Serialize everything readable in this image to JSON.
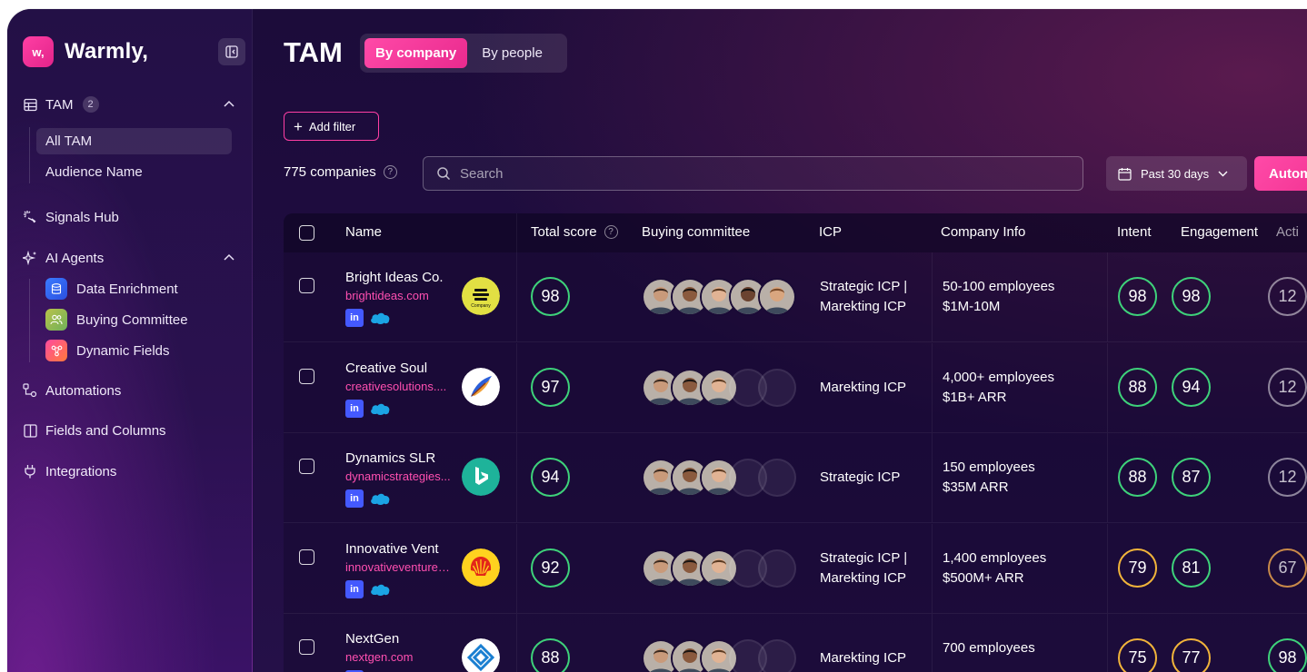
{
  "app": {
    "logo_mark": "w,",
    "brand": "Warmly,"
  },
  "sidebar": {
    "tam": {
      "label": "TAM",
      "count": "2"
    },
    "tam_items": [
      {
        "label": "All TAM"
      },
      {
        "label": "Audience Name"
      }
    ],
    "signals": "Signals Hub",
    "agents": {
      "label": "AI Agents"
    },
    "agent_items": [
      {
        "label": "Data Enrichment"
      },
      {
        "label": "Buying Committee"
      },
      {
        "label": "Dynamic Fields"
      }
    ],
    "automations": "Automations",
    "fields": "Fields and Columns",
    "integrations": "Integrations"
  },
  "header": {
    "title": "TAM",
    "tabs": [
      {
        "label": "By company"
      },
      {
        "label": "By people"
      }
    ],
    "add_filter": "Add filter",
    "company_count": "775 companies",
    "help": "?",
    "search_placeholder": "Search",
    "date_range": "Past 30 days",
    "automate_label": "Autom"
  },
  "table": {
    "columns": {
      "name": "Name",
      "total_score": "Total score",
      "buying_committee": "Buying committee",
      "icp": "ICP",
      "company_info": "Company Info",
      "intent": "Intent",
      "engagement": "Engagement",
      "activity": "Acti"
    },
    "li": "in",
    "rows": [
      {
        "name": "Bright Ideas Co.",
        "domain": "brightideas.com",
        "logo": "company-logo",
        "total": "98",
        "icp_1": "Strategic ICP |",
        "icp_2": "Marekting ICP",
        "info_1": "50-100 employees",
        "info_2": "$1M-10M",
        "intent": "98",
        "engagement": "98",
        "activity": "12",
        "committee_filled": 5
      },
      {
        "name": "Creative Soul",
        "domain": "creativesolutions....",
        "logo": "feather-logo",
        "total": "97",
        "icp_1": "",
        "icp_2": "Marekting ICP",
        "info_1": "4,000+ employees",
        "info_2": "$1B+ ARR",
        "intent": "88",
        "engagement": "94",
        "activity": "12",
        "committee_filled": 3
      },
      {
        "name": "Dynamics SLR",
        "domain": "dynamicstrategies...",
        "logo": "bing-logo",
        "total": "94",
        "icp_1": "",
        "icp_2": "Strategic ICP",
        "info_1": "150 employees",
        "info_2": "$35M ARR",
        "intent": "88",
        "engagement": "87",
        "activity": "12",
        "committee_filled": 3
      },
      {
        "name": "Innovative Vent",
        "domain": "innovativeventures...",
        "logo": "shell-logo",
        "total": "92",
        "icp_1": "Strategic ICP |",
        "icp_2": "Marekting ICP",
        "info_1": "1,400 employees",
        "info_2": "$500M+ ARR",
        "intent": "79",
        "engagement": "81",
        "activity": "67",
        "committee_filled": 3
      },
      {
        "name": "NextGen",
        "domain": "nextgen.com",
        "logo": "nextgen-logo",
        "total": "88",
        "icp_1": "",
        "icp_2": "Marekting ICP",
        "info_1": "700 employees",
        "info_2": "",
        "intent": "75",
        "engagement": "77",
        "activity": "98",
        "committee_filled": 3
      }
    ]
  },
  "colors": {
    "accent": "#ff3fa4",
    "score_green": "#3ed27a",
    "score_amber": "#f1b43a",
    "link": "#ff4fb0"
  }
}
